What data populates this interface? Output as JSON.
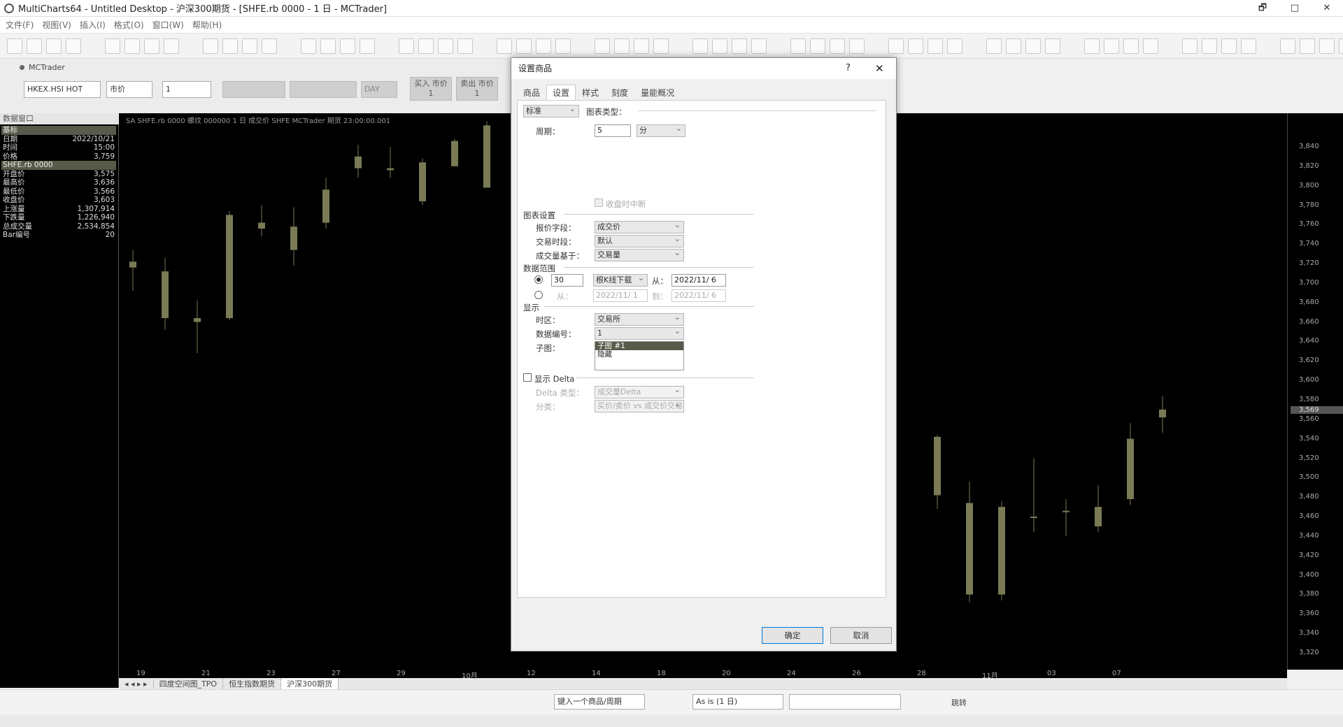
{
  "window": {
    "title": "MultiCharts64 - Untitled Desktop - 沪深300期货 - [SHFE.rb 0000 - 1 日 - MCTrader]",
    "controls": [
      "🗗",
      "□",
      "✕"
    ]
  },
  "menu": [
    "文件(F)",
    "视图(V)",
    "插入(I)",
    "格式(O)",
    "窗口(W)",
    "帮助(H)"
  ],
  "trader_panel": {
    "tab_label": "MCTrader",
    "symbol_value": "HKEX.HSI HOT",
    "order_type": "市价",
    "quantity": "1",
    "tif": "DAY",
    "buy_label": "买入 市价",
    "buy_qty": "1",
    "sell_label": "卖出 市价",
    "sell_qty": "1"
  },
  "data_window": {
    "title": "数据窗口",
    "rows": [
      {
        "k": "基标",
        "v": "",
        "h": true
      },
      {
        "k": "日期",
        "v": "2022/10/21"
      },
      {
        "k": "时间",
        "v": "15:00"
      },
      {
        "k": "价格",
        "v": "3,759"
      },
      {
        "k": "SHFE.rb 0000",
        "v": "",
        "h": true
      },
      {
        "k": "开盘价",
        "v": "3,575"
      },
      {
        "k": "最高价",
        "v": "3,636"
      },
      {
        "k": "最低价",
        "v": "3,566"
      },
      {
        "k": "收盘价",
        "v": "3,603"
      },
      {
        "k": "上涨量",
        "v": "1,307,914"
      },
      {
        "k": "下跌量",
        "v": "1,226,940"
      },
      {
        "k": "总成交量",
        "v": "2,534,854"
      },
      {
        "k": "Bar编号",
        "v": "20"
      }
    ]
  },
  "chart": {
    "info": "SA  SHFE.rb 0000  螺纹 000000  1 日  成交价  SHFE  MCTrader  期货  23:00:00.001",
    "bottom_tabs": [
      "四度空间图_TPO",
      "恒生指数期货",
      "沪深300期货"
    ],
    "active_tab": 2
  },
  "chart_data": {
    "type": "candlestick",
    "title": "",
    "yticks": [
      "3,840",
      "3,820",
      "3,800",
      "3,780",
      "3,760",
      "3,740",
      "3,720",
      "3,700",
      "3,680",
      "3,660",
      "3,640",
      "3,620",
      "3,600",
      "3,580",
      "3,560",
      "3,540",
      "3,520",
      "3,500",
      "3,480",
      "3,460",
      "3,440",
      "3,420",
      "3,400",
      "3,380",
      "3,360",
      "3,340",
      "3,320"
    ],
    "ylim": [
      3320,
      3840
    ],
    "xticks": [
      "19",
      "21",
      "23",
      "27",
      "29",
      "10月",
      "12",
      "14",
      "18",
      "20",
      "24",
      "26",
      "28",
      "11月",
      "03",
      "07"
    ],
    "price_label": "3,569",
    "candles": [
      {
        "o": 3722,
        "h": 3734,
        "l": 3692,
        "c": 3716
      },
      {
        "o": 3712,
        "h": 3726,
        "l": 3652,
        "c": 3664
      },
      {
        "o": 3664,
        "h": 3682,
        "l": 3628,
        "c": 3660
      },
      {
        "o": 3664,
        "h": 3774,
        "l": 3662,
        "c": 3770
      },
      {
        "o": 3756,
        "h": 3780,
        "l": 3748,
        "c": 3762
      },
      {
        "o": 3758,
        "h": 3778,
        "l": 3718,
        "c": 3734
      },
      {
        "o": 3796,
        "h": 3808,
        "l": 3756,
        "c": 3762
      },
      {
        "o": 3818,
        "h": 3842,
        "l": 3808,
        "c": 3830
      },
      {
        "o": 3816,
        "h": 3840,
        "l": 3808,
        "c": 3818
      },
      {
        "o": 3824,
        "h": 3828,
        "l": 3780,
        "c": 3784
      },
      {
        "o": 3846,
        "h": 3848,
        "l": 3820,
        "c": 3820
      },
      {
        "o": 3862,
        "h": 3866,
        "l": 3806,
        "c": 3798
      },
      {
        "o": 3542,
        "h": 3544,
        "l": 3468,
        "c": 3482
      },
      {
        "o": 3474,
        "h": 3496,
        "l": 3372,
        "c": 3380
      },
      {
        "o": 3470,
        "h": 3476,
        "l": 3374,
        "c": 3380
      },
      {
        "o": 3460,
        "h": 3520,
        "l": 3444,
        "c": 3460
      },
      {
        "o": 3466,
        "h": 3478,
        "l": 3440,
        "c": 3466
      },
      {
        "o": 3470,
        "h": 3492,
        "l": 3444,
        "c": 3450
      },
      {
        "o": 3540,
        "h": 3556,
        "l": 3472,
        "c": 3478
      },
      {
        "o": 3570,
        "h": 3584,
        "l": 3546,
        "c": 3562
      }
    ],
    "candle_slots": [
      0,
      1,
      2,
      3,
      4,
      5,
      6,
      7,
      8,
      9,
      10,
      11,
      25,
      26,
      27,
      28,
      29,
      30,
      31,
      32
    ]
  },
  "dialog": {
    "title": "设置商品",
    "help": "?",
    "close": "✕",
    "tabs": [
      "商品",
      "设置",
      "样式",
      "刻度",
      "量能概况"
    ],
    "active_tab": 1,
    "chart_style": "标准",
    "chart_type_label": "图表类型：",
    "period_label": "周期：",
    "period_value": "5",
    "period_unit": "分",
    "session_break": "收盘时中断",
    "chart_settings_section": "图表设置",
    "price_field_label": "报价字段：",
    "price_field_value": "成交价",
    "session_label": "交易时段：",
    "session_value": "默认",
    "volume_label": "成交量基于：",
    "volume_value": "交易量",
    "data_range_section": "数据范围",
    "range_count": "30",
    "range_unit": "根K线下载",
    "from_label": "从：",
    "from_date": "2022/11/ 6",
    "from_label2": "从：",
    "from_date2": "2022/11/ 1",
    "to_label": "到：",
    "to_date": "2022/11/ 6",
    "display_section": "显示",
    "timezone_label": "时区：",
    "timezone_value": "交易所",
    "datanum_label": "数据编号：",
    "datanum_value": "1",
    "subpane_label": "子图：",
    "subpane_items": [
      "子图 #1",
      "隐藏"
    ],
    "delta_label": "显示 Delta",
    "delta_type_label": "Delta 类型：",
    "delta_type_value": "成交量Delta",
    "classify_label": "分类：",
    "classify_value": "买价/卖价 vs 成交价交易",
    "ok": "确定",
    "cancel": "取消"
  },
  "drawbar": {
    "symbol_placeholder": "键入一个商品/周期",
    "as_is": "As is (1 日)",
    "jump_label": "跳转"
  },
  "colors": {
    "candle": "#7a7a55",
    "dialog_accent": "#0078d7"
  }
}
